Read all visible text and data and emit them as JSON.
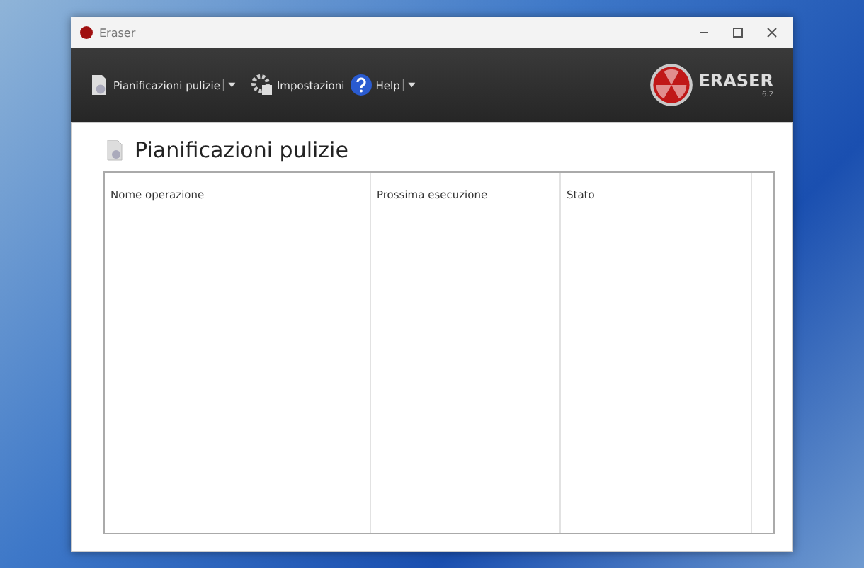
{
  "window": {
    "title": "Eraser"
  },
  "toolbar": [
    {
      "label": "Pianificazioni pulizie",
      "kind": "tasks",
      "dropdown": true
    },
    {
      "label": "Impostazioni",
      "kind": "settings",
      "dropdown": false
    },
    {
      "label": "Help",
      "kind": "help",
      "dropdown": true
    }
  ],
  "logo": {
    "name": "ERASER",
    "version": "6.2"
  },
  "page_title": "Pianificazioni pulizie",
  "table": {
    "columns": [
      "Nome operazione",
      "Prossima esecuzione",
      "Stato"
    ]
  }
}
